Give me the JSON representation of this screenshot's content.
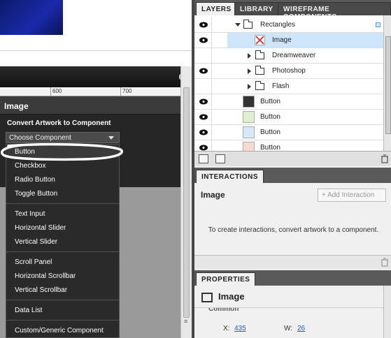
{
  "layers_panel": {
    "tabs": [
      "LAYERS",
      "LIBRARY",
      "WIREFRAME COMPONENTS"
    ],
    "rows": [
      {
        "label": "Rectangles",
        "kind": "folder-open",
        "visible": true
      },
      {
        "label": "Image",
        "kind": "image",
        "visible": true,
        "selected": true
      },
      {
        "label": "Dreamweaver",
        "kind": "folder",
        "visible": false
      },
      {
        "label": "Photoshop",
        "kind": "folder",
        "visible": true
      },
      {
        "label": "Flash",
        "kind": "folder",
        "visible": false
      },
      {
        "label": "Button",
        "kind": "button",
        "visible": true
      },
      {
        "label": "Button",
        "kind": "button",
        "visible": true
      },
      {
        "label": "Button",
        "kind": "button",
        "visible": true
      },
      {
        "label": "Button",
        "kind": "button",
        "visible": true
      }
    ]
  },
  "ruler": {
    "labels": [
      "600",
      "700"
    ]
  },
  "component_panel": {
    "title": "Image",
    "section": "Convert Artwork to Component",
    "select_value": "Choose Component",
    "menu_groups": [
      [
        "Button",
        "Checkbox",
        "Radio Button",
        "Toggle Button"
      ],
      [
        "Text Input",
        "Horizontal Slider",
        "Vertical Slider"
      ],
      [
        "Scroll Panel",
        "Horizontal Scrollbar",
        "Vertical Scrollbar"
      ],
      [
        "Data List"
      ],
      [
        "Custom/Generic Component"
      ]
    ]
  },
  "interactions_panel": {
    "tab": "INTERACTIONS",
    "title": "Image",
    "add_button": "Add Interaction",
    "message": "To create interactions, convert artwork to a component."
  },
  "properties_panel": {
    "tab": "PROPERTIES",
    "title": "Image",
    "section": "Common",
    "x_label": "X:",
    "x_value": "435",
    "w_label": "W:",
    "w_value": "26"
  },
  "colors": {
    "accent": "#cfe5fb",
    "dark_panel": "#262626"
  }
}
